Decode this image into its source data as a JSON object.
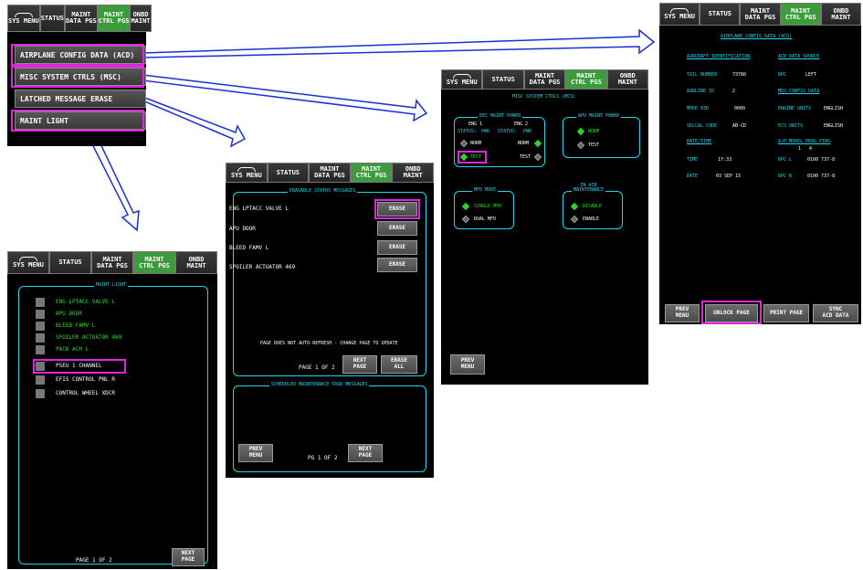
{
  "tabs": [
    {
      "label_top": "",
      "label_bottom": "SYS MENU",
      "icon": "home-arc-icon",
      "active": false
    },
    {
      "label_top": "",
      "label_bottom": "STATUS",
      "active": false
    },
    {
      "label_top": "MAINT",
      "label_bottom": "DATA PGS",
      "active": false
    },
    {
      "label_top": "MAINT",
      "label_bottom": "CTRL PGS",
      "active": true
    },
    {
      "label_top": "ONBD",
      "label_bottom": "MAINT",
      "active": false
    }
  ],
  "colors": {
    "accent_cyan": "#19d7f0",
    "active_green": "#3c9b3c",
    "highlight_magenta": "#e024e0",
    "status_green": "#21e021"
  },
  "ctrl_menu": {
    "items": [
      "AIRPLANE CONFIG DATA (ACD)",
      "MISC SYSTEM CTRLS (MSC)",
      "LATCHED MESSAGE ERASE",
      "MAINT LIGHT"
    ]
  },
  "maint_light": {
    "title": "MAINT LIGHT",
    "items": [
      {
        "label": "ENG LPTACC VALVE L",
        "checked": true
      },
      {
        "label": "APU DOOR",
        "checked": true
      },
      {
        "label": "BLEED FAMV L",
        "checked": true
      },
      {
        "label": "SPOILER ACTUATOR 469",
        "checked": true
      },
      {
        "label": "PACK ACM L",
        "checked": true
      },
      {
        "label": "PSEU 1 CHANNEL",
        "checked": false
      },
      {
        "label": "EFIS CONTROL PNL R",
        "checked": false
      },
      {
        "label": "CONTROL WHEEL XDCR",
        "checked": false
      }
    ],
    "page": "PAGE 1 OF 2",
    "next_top": "NEXT",
    "next_bottom": "PAGE"
  },
  "erase": {
    "box_title": "ERASABLE STATUS MESSAGES",
    "messages": [
      "ENG LPTACC VALVE L",
      "APU DOOR",
      "BLEED FAMV L",
      "SPOILER ACTUATOR 469"
    ],
    "erase_label": "ERASE",
    "note": "PAGE DOES NOT AUTO-REFRESH - CHANGE PAGE TO UPDATE",
    "page": "PAGE 1 OF 2",
    "next_top": "NEXT",
    "next_bottom": "PAGE",
    "erase_all_top": "ERASE",
    "erase_all_bottom": "ALL",
    "sched_title": "SCHEDULED MAINTENANCE TASK MESSAGES",
    "prev_top": "PREV",
    "prev_bottom": "MENU",
    "pg": "PG 1 OF 2",
    "next2_top": "NEXT",
    "next2_bottom": "PAGE"
  },
  "msc": {
    "title": "MISC SYSTEM CTRLS (MCS)",
    "eec_title": "EEC MAINT POWER",
    "eng1": "ENG 1",
    "eng2": "ENG 2",
    "status1": "STATUS:",
    "pwr1": "PWR",
    "status2": "STATUS:",
    "pwr2": "PWR",
    "norm": "NORM",
    "test": "TEST",
    "apu_title": "APU MAINT POWER",
    "apu_norm": "NORM",
    "apu_test": "TEST",
    "mfd_title": "MFD MODE",
    "single": "SINGLE MFD",
    "dual": "DUAL MFD",
    "inair_top": "IN AIR",
    "inair_bottom": "MAINTENANCE",
    "disable": "DISABLE",
    "enable": "ENABLE",
    "prev_top": "PREV",
    "prev_bottom": "MENU"
  },
  "acd": {
    "title": "AIRPLANE CONFIG DATA (ACD)",
    "ident_head": "AIRCRAFT IDENTIFICATION",
    "source_head": "ACD DATA SOURCE",
    "tail_label": "TAIL NUMBER",
    "tail_value": "73780",
    "dpc_label": "DPC",
    "dpc_value": "LEFT",
    "airline_label": "AIRLINE ID",
    "airline_value": "2",
    "mds_head": "MDS CONFIG DATA",
    "mode_label": "MODE A3D",
    "mode_value": "0000",
    "engine_label": "ENGINE UNITS",
    "engine_value": "ENGLISH",
    "selcal_label": "SELCAL CODE",
    "selcal_value": "AB-CD",
    "ecs_label": "ECS UNITS",
    "ecs_value": "ENGLISH",
    "datetime_head": "DATE/TIME",
    "ap_head": "A/P MODEL PROG PINS",
    "pin1": "1",
    "pin2": "4",
    "time_label": "TIME",
    "time_value": "17:33",
    "dpcl_label": "DPC L",
    "dpcl_value": "0100 737-8",
    "date_label": "DATE",
    "date_value": "03 SEP 15",
    "dpcr_label": "DPC R",
    "dpcr_value": "0100 737-8",
    "prev_top": "PREV",
    "prev_bottom": "MENU",
    "unlock": "UNLOCK PAGE",
    "print": "PRINT PAGE",
    "sync_top": "SYNC",
    "sync_bottom": "ACD DATA"
  }
}
